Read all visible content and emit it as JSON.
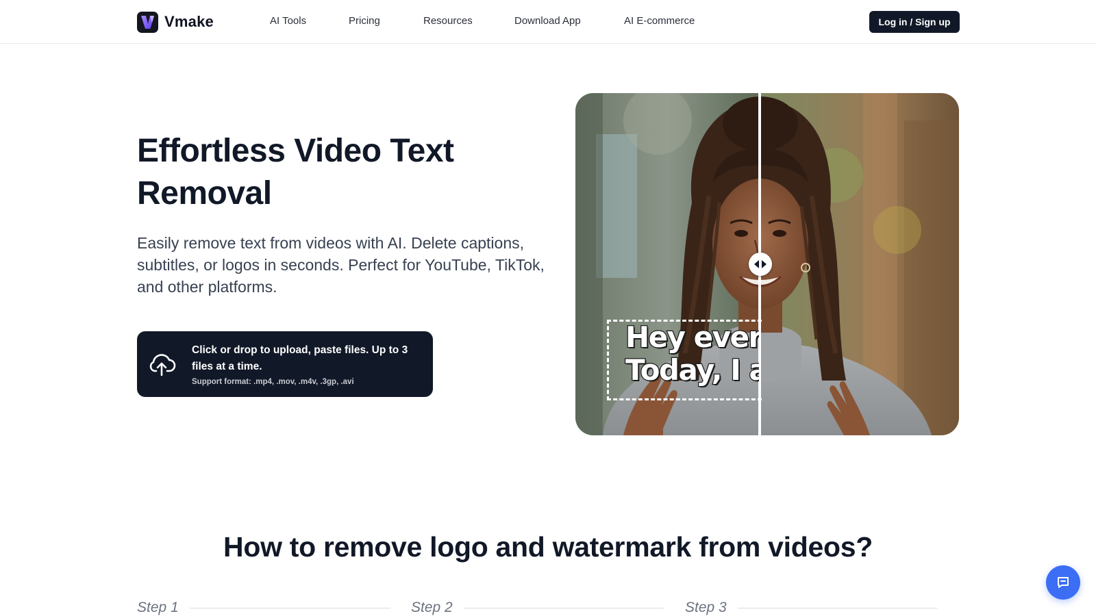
{
  "brand": {
    "name": "Vmake",
    "logo_icon": "vmake-logo-icon",
    "accent": "#7b5cff"
  },
  "nav": {
    "items": [
      {
        "label": "AI Tools"
      },
      {
        "label": "Pricing"
      },
      {
        "label": "Resources"
      },
      {
        "label": "Download App"
      },
      {
        "label": "AI E-commerce"
      }
    ],
    "login_label": "Log in / Sign up"
  },
  "hero": {
    "title": "Effortless Video Text Removal",
    "description": "Easily remove text from videos with AI. Delete captions, subtitles, or logos in seconds. Perfect for YouTube, TikTok, and other platforms.",
    "upload": {
      "icon": "cloud-upload-icon",
      "main_text": "Click or drop to upload, paste files. Up to 3 files at a time.",
      "formats": "Support format: .mp4, .mov, .m4v, .3gp, .avi"
    },
    "compare": {
      "caption_line1": "Hey every",
      "caption_line2": "Today, I a",
      "handle_icon": "compare-arrows-icon"
    }
  },
  "howto": {
    "title": "How to remove logo and watermark from videos?",
    "steps": [
      {
        "label": "Step 1"
      },
      {
        "label": "Step 2"
      },
      {
        "label": "Step 3"
      }
    ]
  },
  "chat": {
    "icon": "chat-icon",
    "color": "#3b6ef5"
  }
}
